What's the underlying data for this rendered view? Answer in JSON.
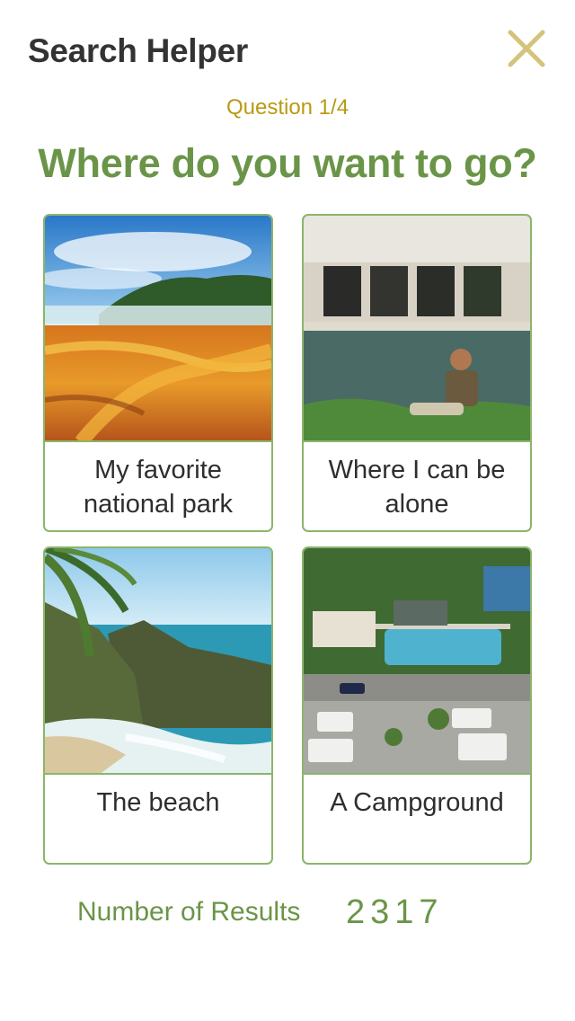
{
  "header": {
    "title": "Search Helper",
    "close_icon": "close-icon"
  },
  "quiz": {
    "progress": "Question 1/4",
    "question": "Where do you want to go?",
    "options": [
      {
        "label": "My favorite national park",
        "image": "hot-spring-landscape-photo"
      },
      {
        "label": "Where I can be alone",
        "image": "man-by-old-bus-photo"
      },
      {
        "label": "The beach",
        "image": "coastal-waterfall-beach-photo"
      },
      {
        "label": "A Campground",
        "image": "rv-campground-aerial-photo"
      }
    ]
  },
  "results": {
    "label": "Number of Results",
    "count": "2317"
  },
  "colors": {
    "accent_green": "#6a9548",
    "border_green": "#8cb56b",
    "gold": "#b99a16",
    "close_icon": "#d4c37a"
  }
}
